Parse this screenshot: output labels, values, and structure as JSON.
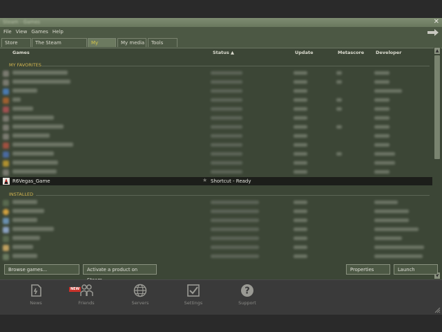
{
  "window": {
    "title": "Steam - Games",
    "close_glyph": "✕"
  },
  "menu": {
    "items": [
      "File",
      "View",
      "Games",
      "Help"
    ]
  },
  "tabs": [
    {
      "label": "Store"
    },
    {
      "label": "The Steam Community"
    },
    {
      "label": "My games"
    },
    {
      "label": "My media"
    },
    {
      "label": "Tools"
    }
  ],
  "active_tab": "My games",
  "columns": {
    "games": "Games",
    "status": "Status",
    "status_sort_glyph": "▲",
    "update": "Update",
    "metascore": "Metascore",
    "developer": "Developer"
  },
  "sections": {
    "favorites": "MY FAVORITES",
    "installed": "INSTALLED"
  },
  "selected_row": {
    "name": "R6Vegas_Game",
    "star_glyph": "★",
    "status": "Shortcut - Ready"
  },
  "buttons": {
    "browse": "Browse games...",
    "activate": "Activate a product on Steam...",
    "properties": "Properties",
    "launch": "Launch"
  },
  "bottom_nav": [
    {
      "label": "News",
      "icon": "news-icon"
    },
    {
      "label": "Friends",
      "icon": "friends-icon",
      "badge": "NEW"
    },
    {
      "label": "Servers",
      "icon": "globe-icon"
    },
    {
      "label": "Settings",
      "icon": "checkbox-icon"
    },
    {
      "label": "Support",
      "icon": "question-icon"
    }
  ],
  "colors": {
    "window_bg": "#4c5844",
    "list_bg": "#3c4636",
    "selected_row_bg": "#1c1e1a",
    "active_tab_text": "#d4c54a",
    "section_header": "#d4b650",
    "new_badge": "#c8322a"
  }
}
